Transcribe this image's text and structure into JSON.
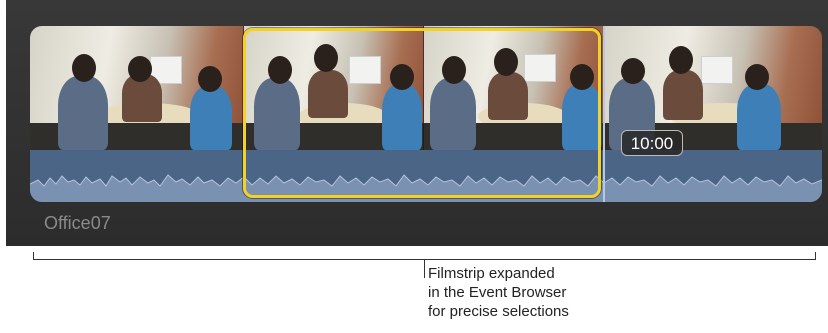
{
  "clip": {
    "name": "Office07",
    "timecode": "10:00"
  },
  "callout": {
    "line1": "Filmstrip expanded",
    "line2": "in the Event Browser",
    "line3": "for precise selections"
  },
  "colors": {
    "selection_border": "#f2d224",
    "waveform_fill": "#8aa0c0",
    "waveform_bg": "#4b6587"
  }
}
